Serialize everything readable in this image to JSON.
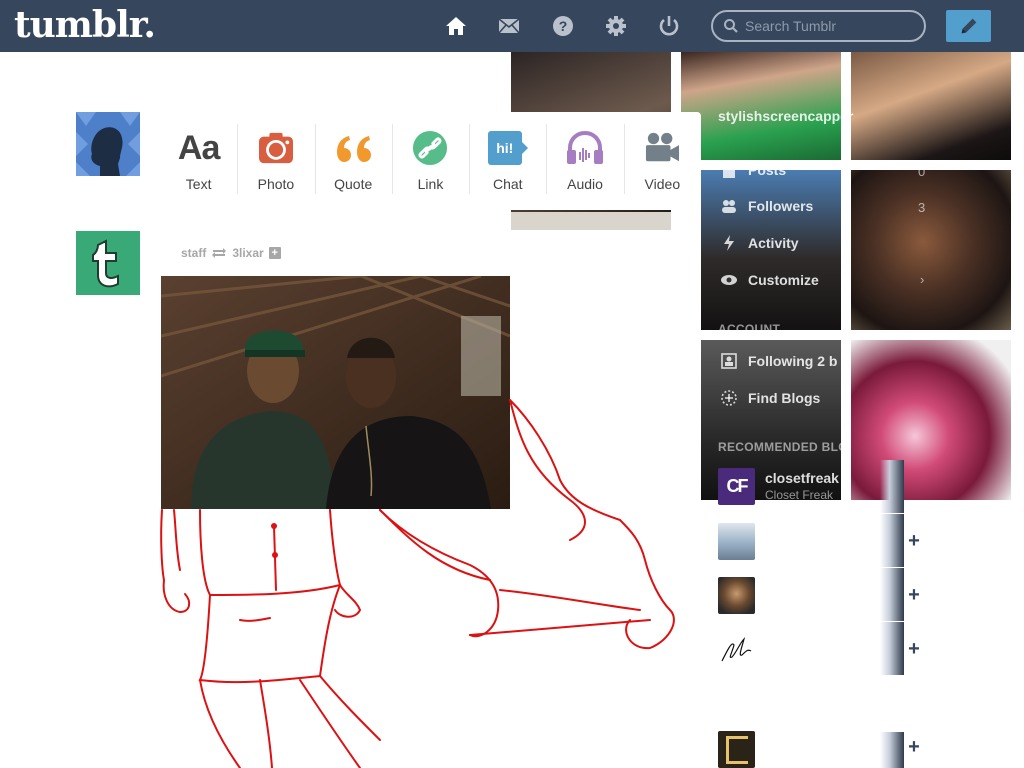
{
  "header": {
    "logo": "tumblr.",
    "search": {
      "placeholder": "Search Tumblr",
      "value": ""
    },
    "nav_icons": [
      "home-icon",
      "mail-icon",
      "help-icon",
      "settings-icon",
      "power-icon"
    ],
    "compose_icon": "pencil-icon"
  },
  "composer": {
    "items": [
      {
        "label": "Text",
        "icon": "text-icon",
        "color": "#444444"
      },
      {
        "label": "Photo",
        "icon": "camera-icon",
        "color": "#d95e40"
      },
      {
        "label": "Quote",
        "icon": "quote-icon",
        "color": "#f2992e"
      },
      {
        "label": "Link",
        "icon": "link-icon",
        "color": "#56bc8a"
      },
      {
        "label": "Chat",
        "icon": "chat-icon",
        "color": "#529ecc"
      },
      {
        "label": "Audio",
        "icon": "headphones-icon",
        "color": "#a77dc2"
      },
      {
        "label": "Video",
        "icon": "video-camera-icon",
        "color": "#748089"
      }
    ],
    "chat_badge": "hi!"
  },
  "post": {
    "author": "staff",
    "reblogged_from": "3lixar"
  },
  "sidebar": {
    "blog_name": "stylishscreencapper",
    "menu": [
      {
        "label": "Posts",
        "count": "0",
        "icon": "posts-icon"
      },
      {
        "label": "Followers",
        "count": "3",
        "icon": "followers-icon"
      },
      {
        "label": "Activity",
        "count": "",
        "icon": "activity-icon"
      },
      {
        "label": "Customize",
        "count": "",
        "icon": "eye-icon"
      }
    ],
    "account_heading": "ACCOUNT",
    "account_items": [
      {
        "label": "Following 2 b",
        "icon": "following-icon"
      },
      {
        "label": "Find Blogs",
        "icon": "find-blogs-icon"
      }
    ],
    "recommended_heading": "RECOMMENDED BLO",
    "recommended": [
      {
        "name": "closetfreak",
        "subtitle": "Closet Freak",
        "avatar_text": "CF"
      }
    ],
    "follow_plus": "+"
  },
  "colors": {
    "header_bg": "#36465d",
    "accent": "#529ecc",
    "staff_green": "#3aa978"
  }
}
